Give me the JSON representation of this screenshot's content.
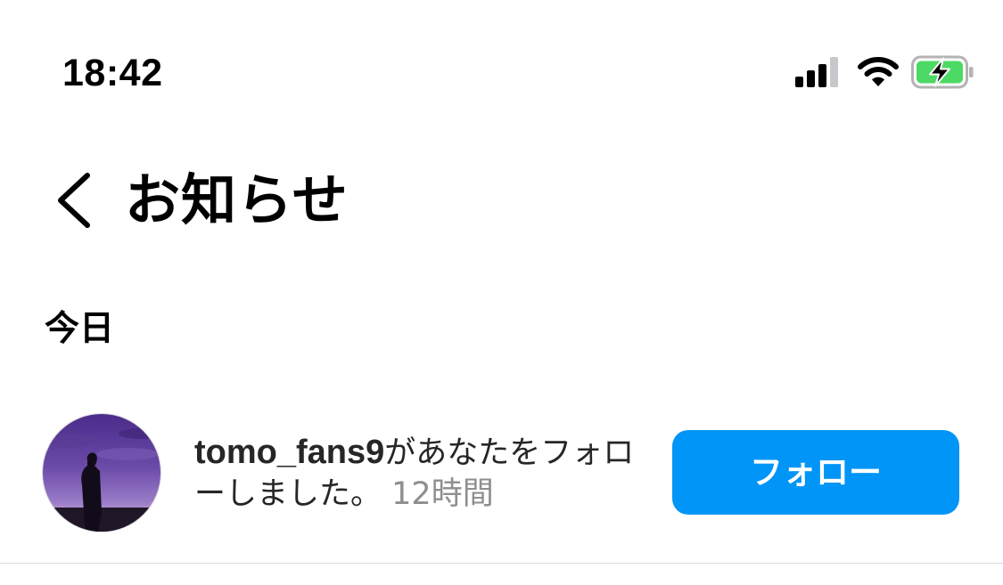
{
  "status_bar": {
    "time": "18:42",
    "icons": [
      "signal-icon",
      "wifi-icon",
      "battery-charging-icon"
    ],
    "battery_color": "#4cd964"
  },
  "header": {
    "back_icon": "chevron-left-icon",
    "title": "お知らせ"
  },
  "sections": [
    {
      "title": "今日",
      "notifications": [
        {
          "avatar": "avatar-image",
          "username": "tomo_fans9",
          "message": "があなたをフォローしました。",
          "time": "12時間",
          "button_label": "フォロー"
        }
      ]
    }
  ],
  "colors": {
    "follow_button": "#0095f6",
    "secondary_text": "#8e8e8e",
    "divider": "#dbdbdb"
  }
}
